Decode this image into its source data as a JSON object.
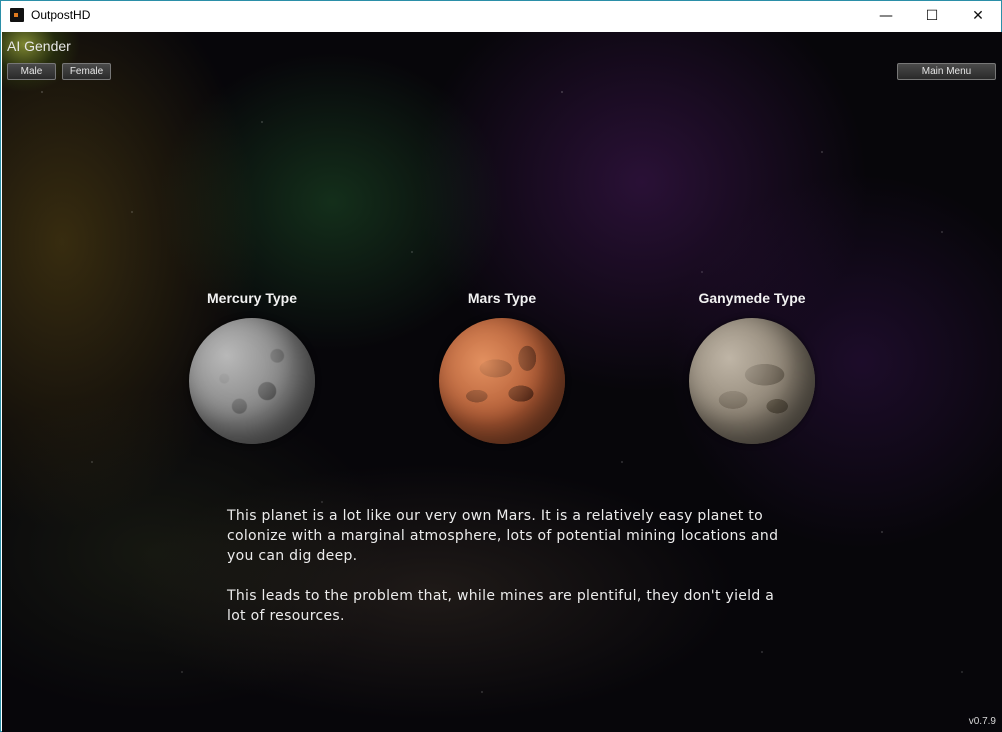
{
  "window": {
    "title": "OutpostHD",
    "minimize_glyph": "—",
    "maximize_glyph": "☐",
    "close_glyph": "✕"
  },
  "ai_gender": {
    "label": "AI Gender",
    "male_label": "Male",
    "female_label": "Female"
  },
  "main_menu_label": "Main Menu",
  "planets": [
    {
      "name": "Mercury Type"
    },
    {
      "name": "Mars Type"
    },
    {
      "name": "Ganymede Type"
    }
  ],
  "description": {
    "paragraph1": "This planet is a lot like our very own Mars. It is a relatively easy planet to colonize with a marginal atmosphere, lots of potential mining locations and you can dig deep.",
    "paragraph2": "This leads to the problem that, while mines are plentiful, they don't yield a lot of resources."
  },
  "version": "v0.7.9"
}
